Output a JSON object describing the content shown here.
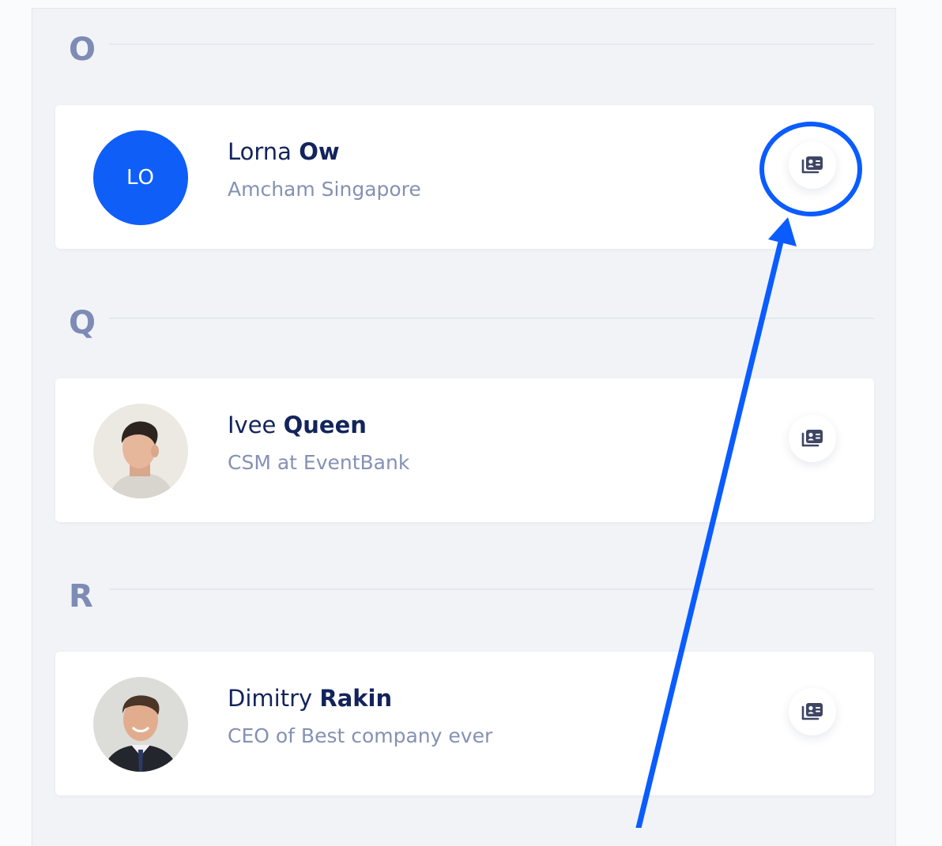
{
  "sections": [
    {
      "letter": "O",
      "contact": {
        "initials": "LO",
        "first_name": "Lorna",
        "last_name": "Ow",
        "subtitle": "Amcham Singapore"
      }
    },
    {
      "letter": "Q",
      "contact": {
        "first_name": "Ivee",
        "last_name": "Queen",
        "subtitle": "CSM at EventBank"
      }
    },
    {
      "letter": "R",
      "contact": {
        "first_name": "Dimitry",
        "last_name": "Rakin",
        "subtitle": "CEO of Best company ever"
      }
    }
  ],
  "icons": {
    "card_button": "contact-card-icon"
  },
  "colors": {
    "accent": "#0f5ef7",
    "annotation": "#0a5cff",
    "name_text": "#13245b",
    "subtitle_text": "#8591b3",
    "section_letter": "#7d8bb5",
    "panel_background": "#f1f3f7"
  }
}
